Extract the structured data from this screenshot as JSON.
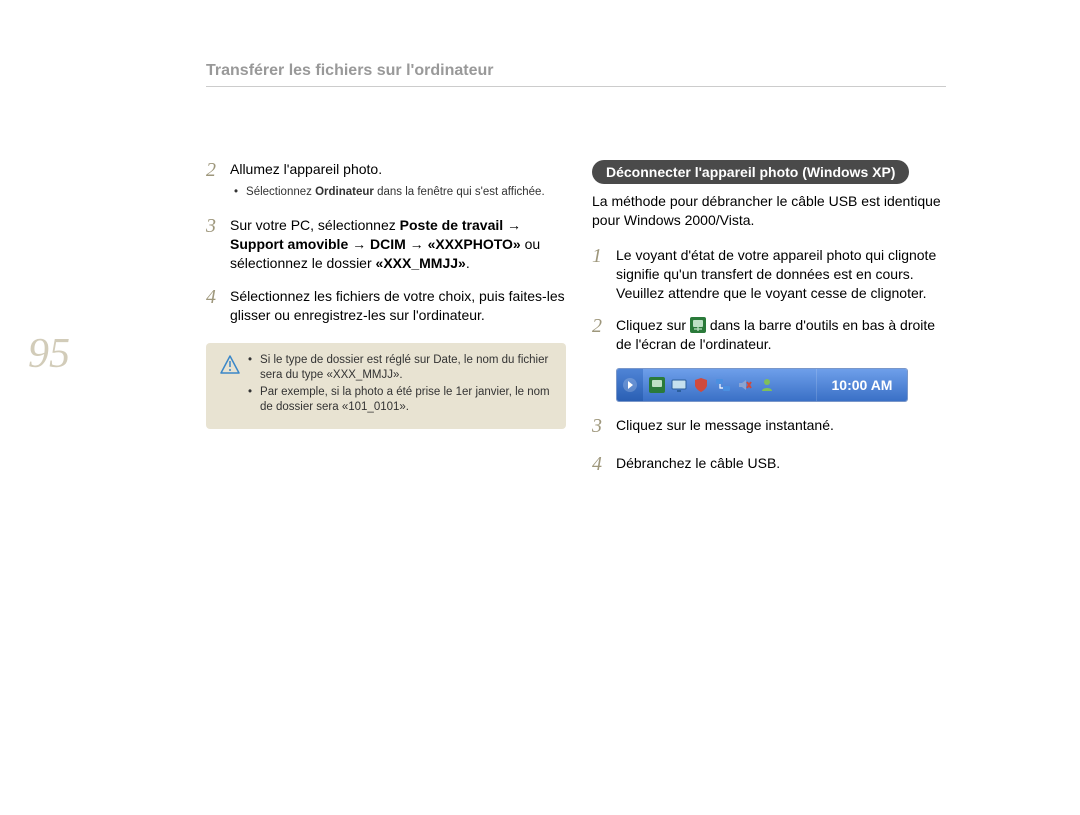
{
  "header": {
    "title": "Transférer les fichiers sur l'ordinateur"
  },
  "pageNumber": "95",
  "left": {
    "step2": {
      "num": "2",
      "text": "Allumez l'appareil photo.",
      "bullet_prefix": "Sélectionnez ",
      "bullet_bold": "Ordinateur",
      "bullet_suffix": " dans la fenêtre qui s'est affichée."
    },
    "step3": {
      "num": "3",
      "prefix": "Sur votre PC, sélectionnez ",
      "bold1": "Poste de travail",
      "arrow1": " → ",
      "bold2": "Support amovible",
      "arrow2": " → ",
      "bold3": "DCIM",
      "arrow3": " → ",
      "bold4": "«XXXPHOTO»",
      "mid": " ou sélectionnez le dossier ",
      "bold5": "«XXX_MMJJ»",
      "end": "."
    },
    "step4": {
      "num": "4",
      "text": "Sélectionnez les fichiers de votre choix, puis faites-les glisser ou enregistrez-les sur l'ordinateur."
    },
    "note": {
      "item1": "Si le type de dossier est réglé sur Date, le nom du fichier sera du type «XXX_MMJJ».",
      "item2": "Par exemple, si la photo a été prise le 1er janvier, le nom de dossier sera «101_0101»."
    }
  },
  "right": {
    "heading": "Déconnecter l'appareil photo (Windows XP)",
    "intro": "La méthode pour débrancher le câble USB est identique pour Windows 2000/Vista.",
    "step1": {
      "num": "1",
      "text": "Le voyant d'état de votre appareil photo qui clignote signifie qu'un transfert de données est en cours. Veuillez attendre que le voyant cesse de clignoter."
    },
    "step2": {
      "num": "2",
      "prefix": "Cliquez sur ",
      "suffix": " dans la barre d'outils en bas à droite de l'écran de l'ordinateur."
    },
    "systray": {
      "clock": "10:00 AM"
    },
    "step3": {
      "num": "3",
      "text": "Cliquez sur le message instantané."
    },
    "step4": {
      "num": "4",
      "text": "Débranchez le câble USB."
    }
  }
}
